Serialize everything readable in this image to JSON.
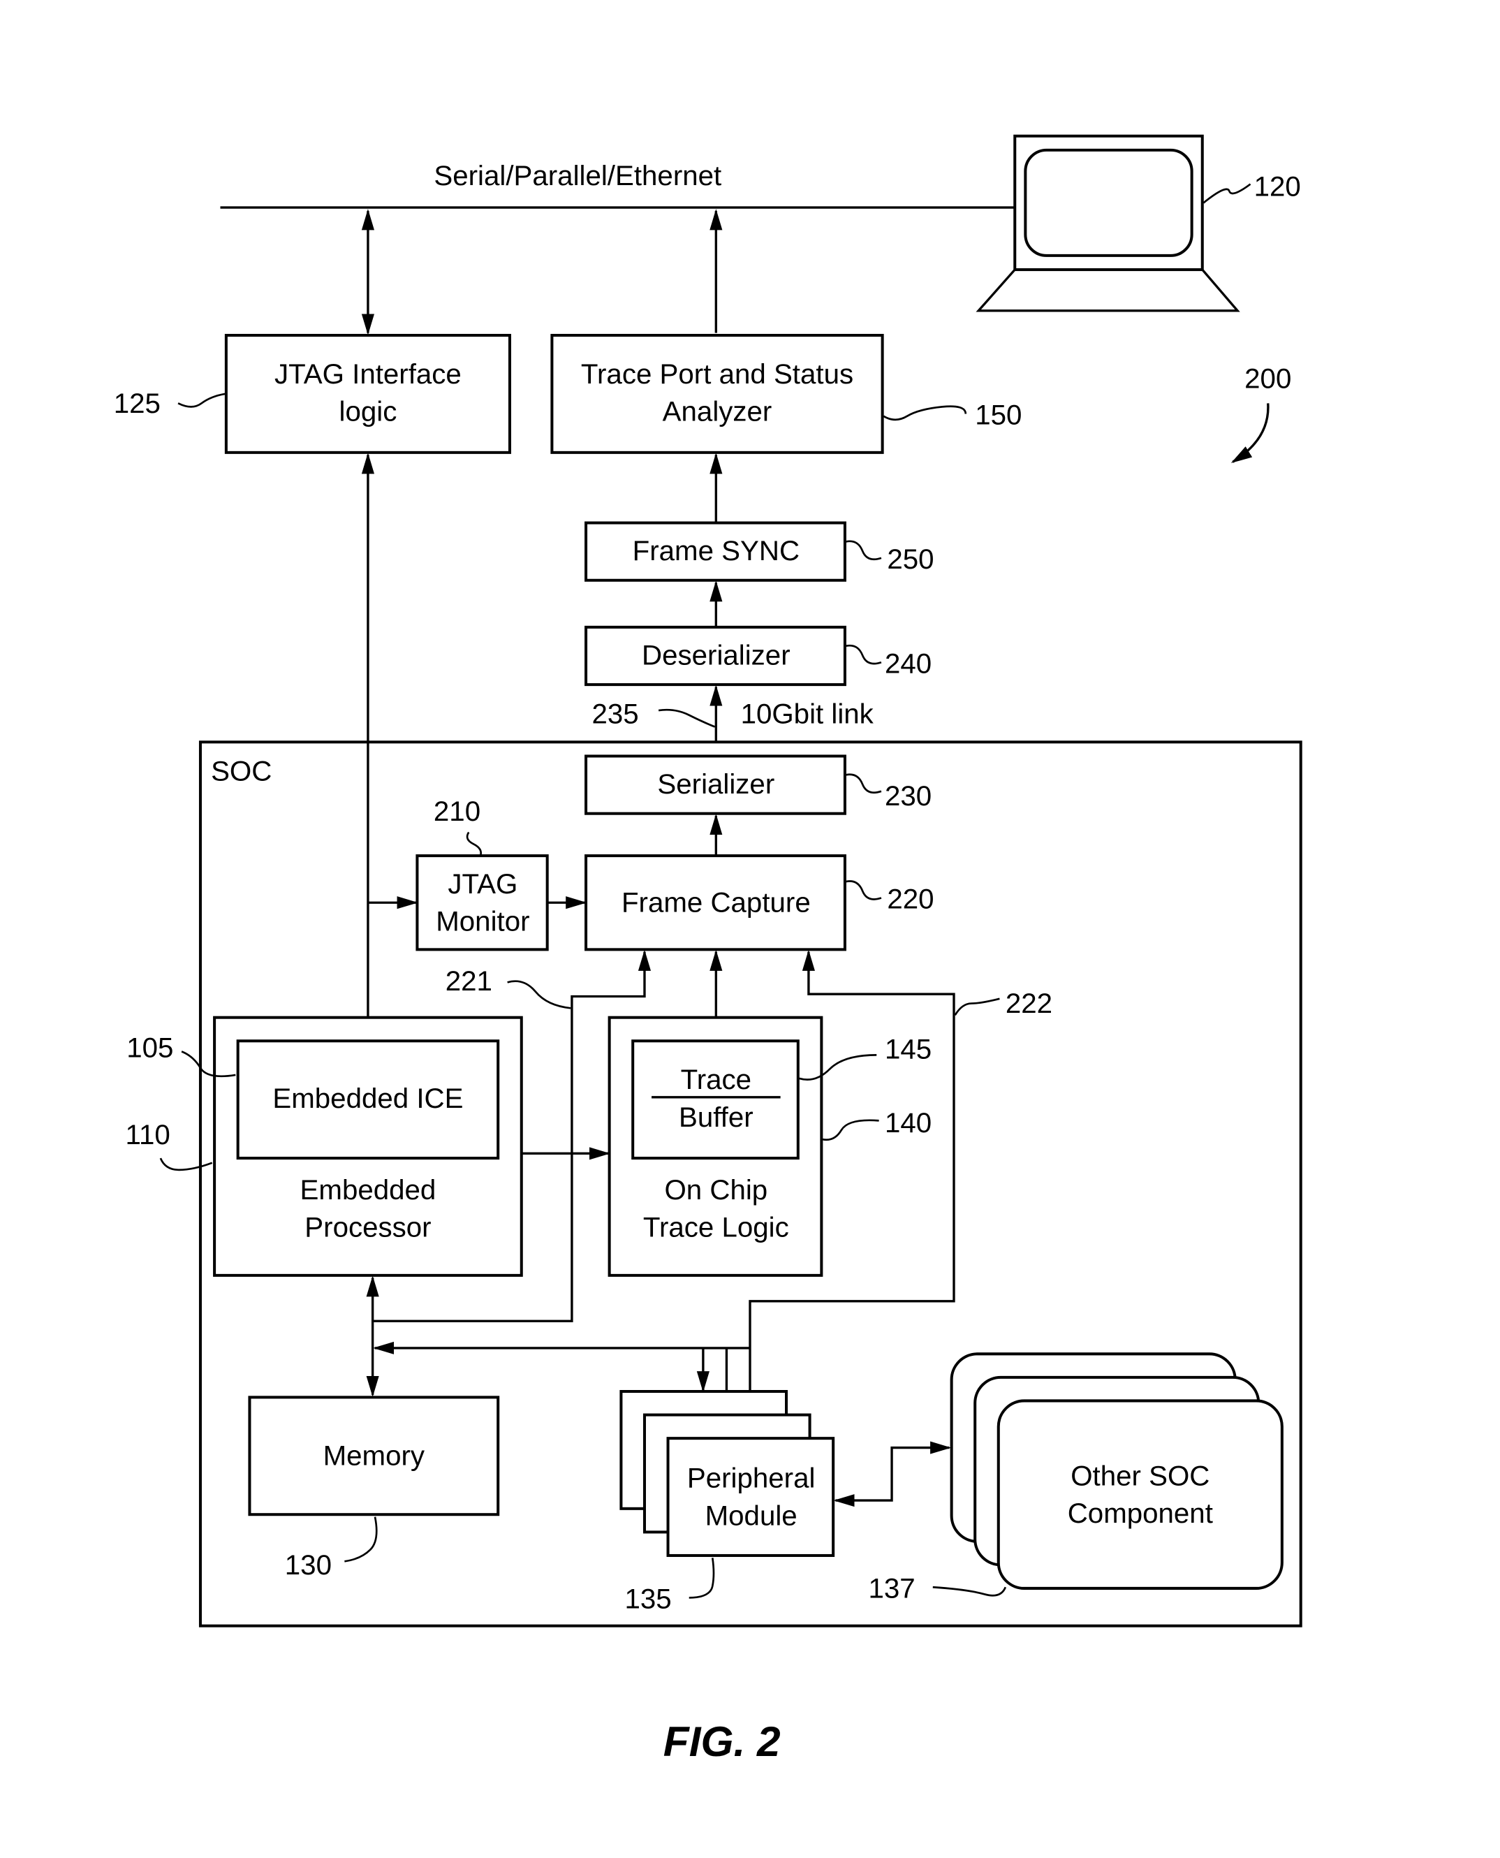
{
  "figure": {
    "caption": "FIG. 2",
    "ref": "200"
  },
  "bus": {
    "label": "Serial/Parallel/Ethernet"
  },
  "computer": {
    "ref": "120"
  },
  "jtag_interface": {
    "line1": "JTAG Interface",
    "line2": "logic",
    "ref": "125"
  },
  "trace_analyzer": {
    "line1": "Trace Port and Status",
    "line2": "Analyzer",
    "ref": "150"
  },
  "frame_sync": {
    "label": "Frame SYNC",
    "ref": "250"
  },
  "deserializer": {
    "label": "Deserializer",
    "ref": "240"
  },
  "link": {
    "label": "10Gbit link",
    "ref": "235"
  },
  "soc": {
    "label": "SOC"
  },
  "serializer": {
    "label": "Serializer",
    "ref": "230"
  },
  "jtag_monitor": {
    "line1": "JTAG",
    "line2": "Monitor",
    "ref": "210"
  },
  "frame_capture": {
    "label": "Frame Capture",
    "ref": "220"
  },
  "bus_221": {
    "ref": "221"
  },
  "bus_222": {
    "ref": "222"
  },
  "embedded_ice": {
    "label": "Embedded ICE",
    "ref": "105"
  },
  "embedded_processor": {
    "line1": "Embedded",
    "line2": "Processor",
    "ref": "110"
  },
  "trace_buffer": {
    "line1": "Trace",
    "line2": "Buffer",
    "ref": "145"
  },
  "on_chip_trace": {
    "line1": "On Chip",
    "line2": "Trace Logic",
    "ref": "140"
  },
  "memory": {
    "label": "Memory",
    "ref": "130"
  },
  "peripheral": {
    "line1": "Peripheral",
    "line2": "Module",
    "ref": "135"
  },
  "other_soc": {
    "line1": "Other SOC",
    "line2": "Component",
    "ref": "137"
  }
}
